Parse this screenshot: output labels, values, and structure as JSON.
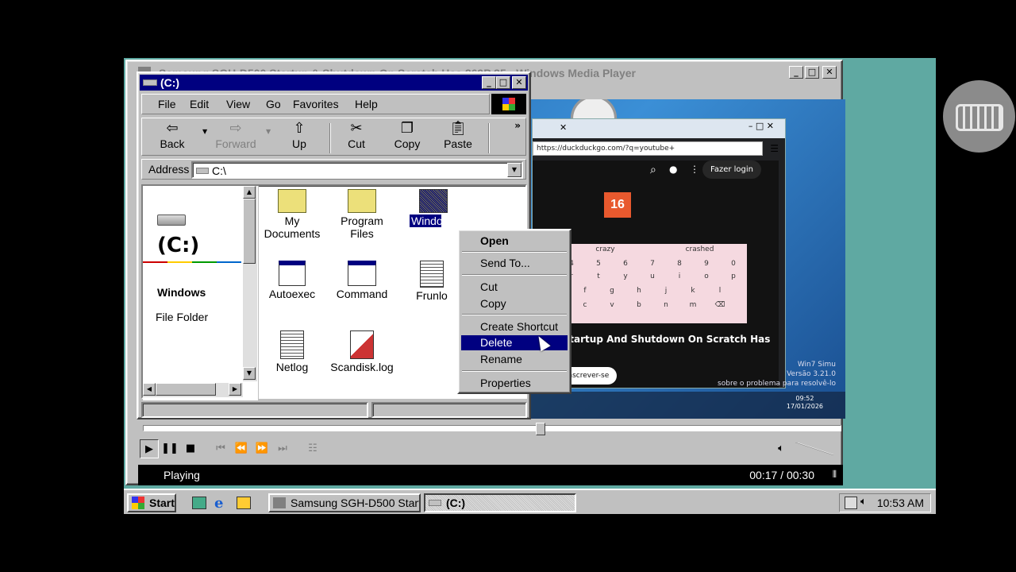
{
  "wmp": {
    "title": "Samsung SGH-D500 Startup & Shutdown On Scratch Has 869P 35 - Windows Media Player",
    "status": "Playing",
    "time": "00:17 / 00:30",
    "progress": 0.57
  },
  "video": {
    "url": "https://duckduckgo.com/?q=youtube+",
    "login": "Fazer login",
    "kbd_suggestions": [
      "crazy",
      "crashed"
    ],
    "kbd_row1": [
      "4",
      "5",
      "6",
      "7",
      "8",
      "9",
      "0"
    ],
    "kbd_row2": [
      "r",
      "t",
      "y",
      "u",
      "i",
      "o",
      "p"
    ],
    "kbd_row3": [
      "f",
      "g",
      "h",
      "j",
      "k",
      "l"
    ],
    "kbd_row4": [
      "c",
      "v",
      "b",
      "n",
      "m",
      "⌫"
    ],
    "video_title": ") Startup And Shutdown On Scratch Has",
    "subscribe": "Inscrever-se",
    "sim_name": "Win7 Simu",
    "sim_version": "Versão 3.21.0",
    "sim_note": "sobre o problema para resolvê-lo",
    "clock_time": "09:52",
    "clock_date": "17/01/2026",
    "calendar_day": "16"
  },
  "explorer": {
    "title": "(C:)",
    "menus": [
      "File",
      "Edit",
      "View",
      "Go",
      "Favorites",
      "Help"
    ],
    "toolbar": {
      "back": "Back",
      "forward": "Forward",
      "up": "Up",
      "cut": "Cut",
      "copy": "Copy",
      "paste": "Paste"
    },
    "address_label": "Address",
    "address_value": "C:\\",
    "drive_heading": "(C:)",
    "selected_name": "Windows",
    "selected_type": "File Folder",
    "items": {
      "my_documents": "My Documents",
      "program_files": "Program Files",
      "windows": "Windo",
      "autoexec": "Autoexec",
      "command": "Command",
      "frunlog": "Frunlo",
      "netlog": "Netlog",
      "scandisk": "Scandisk.log"
    }
  },
  "context_menu": {
    "open": "Open",
    "send_to": "Send To...",
    "cut": "Cut",
    "copy": "Copy",
    "create_shortcut": "Create Shortcut",
    "delete": "Delete",
    "rename": "Rename",
    "properties": "Properties"
  },
  "taskbar": {
    "start": "Start",
    "task1": "Samsung SGH-D500 Startu...",
    "task2": "(C:)",
    "clock": "10:53 AM"
  },
  "colors": {
    "desktop": "#5fa9a2",
    "title_active": "#000080",
    "face": "#c0c0c0"
  }
}
